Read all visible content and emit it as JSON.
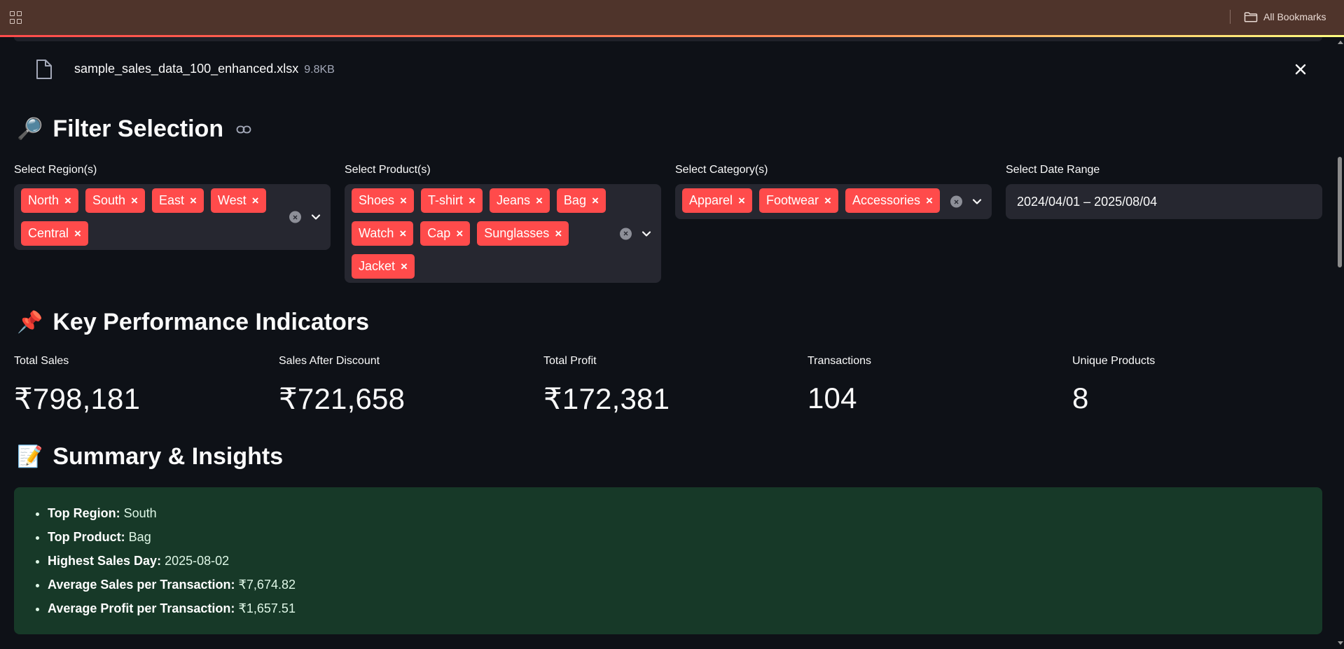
{
  "browser": {
    "bookmarks_label": "All Bookmarks"
  },
  "upload": {
    "file_name": "sample_sales_data_100_enhanced.xlsx",
    "file_size": "9.8KB"
  },
  "filters": {
    "title_emoji": "🔎",
    "title": "Filter Selection",
    "region": {
      "label": "Select Region(s)",
      "tags": [
        "North",
        "South",
        "East",
        "West",
        "Central"
      ]
    },
    "product": {
      "label": "Select Product(s)",
      "tags": [
        "Shoes",
        "T-shirt",
        "Jeans",
        "Bag",
        "Watch",
        "Cap",
        "Sunglasses",
        "Jacket"
      ]
    },
    "category": {
      "label": "Select Category(s)",
      "tags": [
        "Apparel",
        "Footwear",
        "Accessories"
      ]
    },
    "date": {
      "label": "Select Date Range",
      "value": "2024/04/01 – 2025/08/04"
    }
  },
  "kpis": {
    "title_emoji": "📌",
    "title": "Key Performance Indicators",
    "items": [
      {
        "label": "Total Sales",
        "value": "₹798,181"
      },
      {
        "label": "Sales After Discount",
        "value": "₹721,658"
      },
      {
        "label": "Total Profit",
        "value": "₹172,381"
      },
      {
        "label": "Transactions",
        "value": "104"
      },
      {
        "label": "Unique Products",
        "value": "8"
      }
    ]
  },
  "summary": {
    "title_emoji": "📝",
    "title": "Summary & Insights",
    "items": [
      {
        "key": "Top Region:",
        "value": "South"
      },
      {
        "key": "Top Product:",
        "value": "Bag"
      },
      {
        "key": "Highest Sales Day:",
        "value": "2025-08-02"
      },
      {
        "key": "Average Sales per Transaction:",
        "value": "₹7,674.82"
      },
      {
        "key": "Average Profit per Transaction:",
        "value": "₹1,657.51"
      }
    ]
  },
  "colors": {
    "background": "#0e1117",
    "tag": "#ff4b4b",
    "input_bg": "#262730",
    "summary_bg": "#173928",
    "browser_bar": "#4f342b"
  },
  "icons": {
    "apps": "apps-grid-icon",
    "folder": "folder-icon",
    "file": "file-icon",
    "close": "close-icon",
    "link": "link-icon",
    "clear": "clear-icon",
    "chevron": "chevron-down-icon"
  }
}
